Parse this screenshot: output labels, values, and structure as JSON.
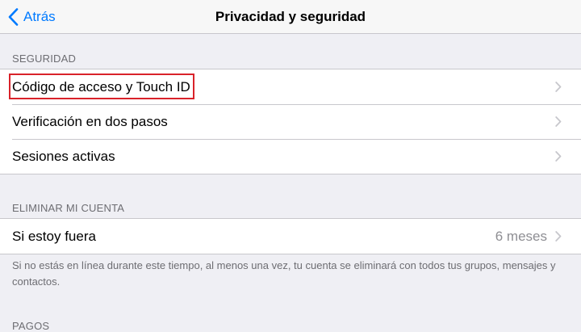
{
  "navbar": {
    "back_label": "Atrás",
    "title": "Privacidad y seguridad"
  },
  "sections": {
    "security": {
      "header": "SEGURIDAD",
      "rows": [
        {
          "label": "Código de acceso y Touch ID"
        },
        {
          "label": "Verificación en dos pasos"
        },
        {
          "label": "Sesiones activas"
        }
      ]
    },
    "delete_account": {
      "header": "ELIMINAR MI CUENTA",
      "rows": [
        {
          "label": "Si estoy fuera",
          "value": "6 meses"
        }
      ],
      "footer": "Si no estás en línea durante este tiempo, al menos una vez, tu cuenta se eliminará con todos tus grupos, mensajes y contactos."
    },
    "payments": {
      "header": "PAGOS"
    }
  },
  "colors": {
    "accent": "#007aff",
    "highlight": "#d9222a",
    "background": "#efeff4"
  },
  "icons": {
    "back": "chevron-left-icon",
    "disclosure": "chevron-right-icon"
  }
}
